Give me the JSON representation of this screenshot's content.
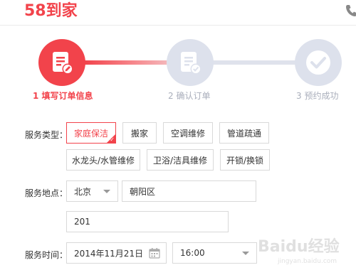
{
  "header": {
    "logo_text": "58到家",
    "phone_icon": "phone-icon"
  },
  "steps": [
    {
      "label": "1 填写订单信息",
      "state": "active",
      "icon": "form-edit-icon"
    },
    {
      "label": "2 确认订单",
      "state": "pending",
      "icon": "form-check-icon"
    },
    {
      "label": "3 预约成功",
      "state": "pending",
      "icon": "checkmark-icon"
    }
  ],
  "form": {
    "service_type": {
      "label": "服务类型：",
      "options": [
        "家庭保洁",
        "搬家",
        "空调维修",
        "管道疏通",
        "水龙头/水管维修",
        "卫浴/洁具维修",
        "开锁/换锁"
      ],
      "selected": "家庭保洁"
    },
    "service_location": {
      "label": "服务地点：",
      "city": "北京",
      "district": "朝阳区",
      "address": "201"
    },
    "service_time": {
      "label": "服务时间：",
      "date": "2014年11月21日",
      "time": "16:00"
    }
  },
  "watermark": {
    "text": "Baidu经验",
    "subtext": "jingyan.baidu.com"
  },
  "colors": {
    "accent": "#f2434b",
    "step_inactive": "#dde1ec",
    "step_label_inactive": "#a9aebb",
    "border": "#d9d9d9"
  }
}
